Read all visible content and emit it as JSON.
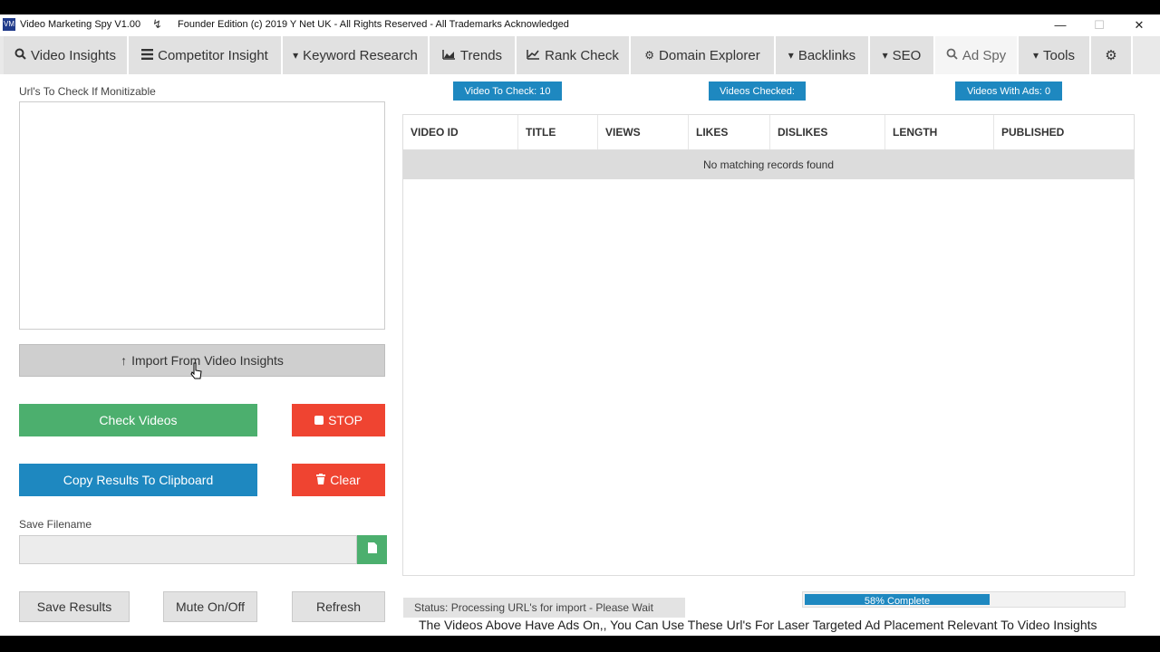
{
  "window": {
    "app_title": "Video Marketing Spy V1.00",
    "edition_text": "Founder Edition (c) 2019 Y Net UK - All Rights Reserved - All Trademarks Acknowledged",
    "minimize": "—",
    "maximize": "☐",
    "close": "✕"
  },
  "tabs": [
    {
      "label": "Video Insights",
      "icon": "search-icon"
    },
    {
      "label": "Competitor Insight",
      "icon": "list-icon"
    },
    {
      "label": "Keyword Research",
      "icon": "caret-down-icon"
    },
    {
      "label": "Trends",
      "icon": "area-chart-icon"
    },
    {
      "label": "Rank Check",
      "icon": "line-chart-icon"
    },
    {
      "label": "Domain Explorer",
      "icon": "gear-icon"
    },
    {
      "label": "Backlinks",
      "icon": "caret-down-icon"
    },
    {
      "label": "SEO",
      "icon": "caret-down-icon"
    },
    {
      "label": "Ad Spy",
      "icon": "search-icon",
      "active": true
    },
    {
      "label": "Tools",
      "icon": "caret-down-icon"
    },
    {
      "label": "",
      "icon": "cogs-icon"
    }
  ],
  "left": {
    "urls_label": "Url's To Check If Monitizable",
    "import_button": "Import From Video Insights",
    "check_button": "Check Videos",
    "stop_button": "STOP",
    "copy_button": "Copy Results To Clipboard",
    "clear_button": "Clear",
    "save_label": "Save Filename",
    "save_value": "",
    "save_results_button": "Save Results",
    "mute_button": "Mute On/Off",
    "refresh_button": "Refresh"
  },
  "badges": {
    "to_check": "Video To Check: 10",
    "checked": "Videos Checked:",
    "with_ads": "Videos With Ads: 0"
  },
  "table": {
    "columns": [
      "VIDEO ID",
      "TITLE",
      "VIEWS",
      "LIKES",
      "DISLIKES",
      "LENGTH",
      "PUBLISHED"
    ],
    "empty_message": "No matching records found"
  },
  "status": {
    "text": "Status: Processing URL's for import - Please Wait",
    "progress_label": "58% Complete",
    "progress_value": 0.58
  },
  "footer_note": "The Videos Above Have Ads On,, You Can Use These Url's For Laser Targeted Ad Placement Relevant To Video Insights",
  "colors": {
    "green": "#4caf6e",
    "red": "#ef4431",
    "blue": "#1e88c0"
  }
}
